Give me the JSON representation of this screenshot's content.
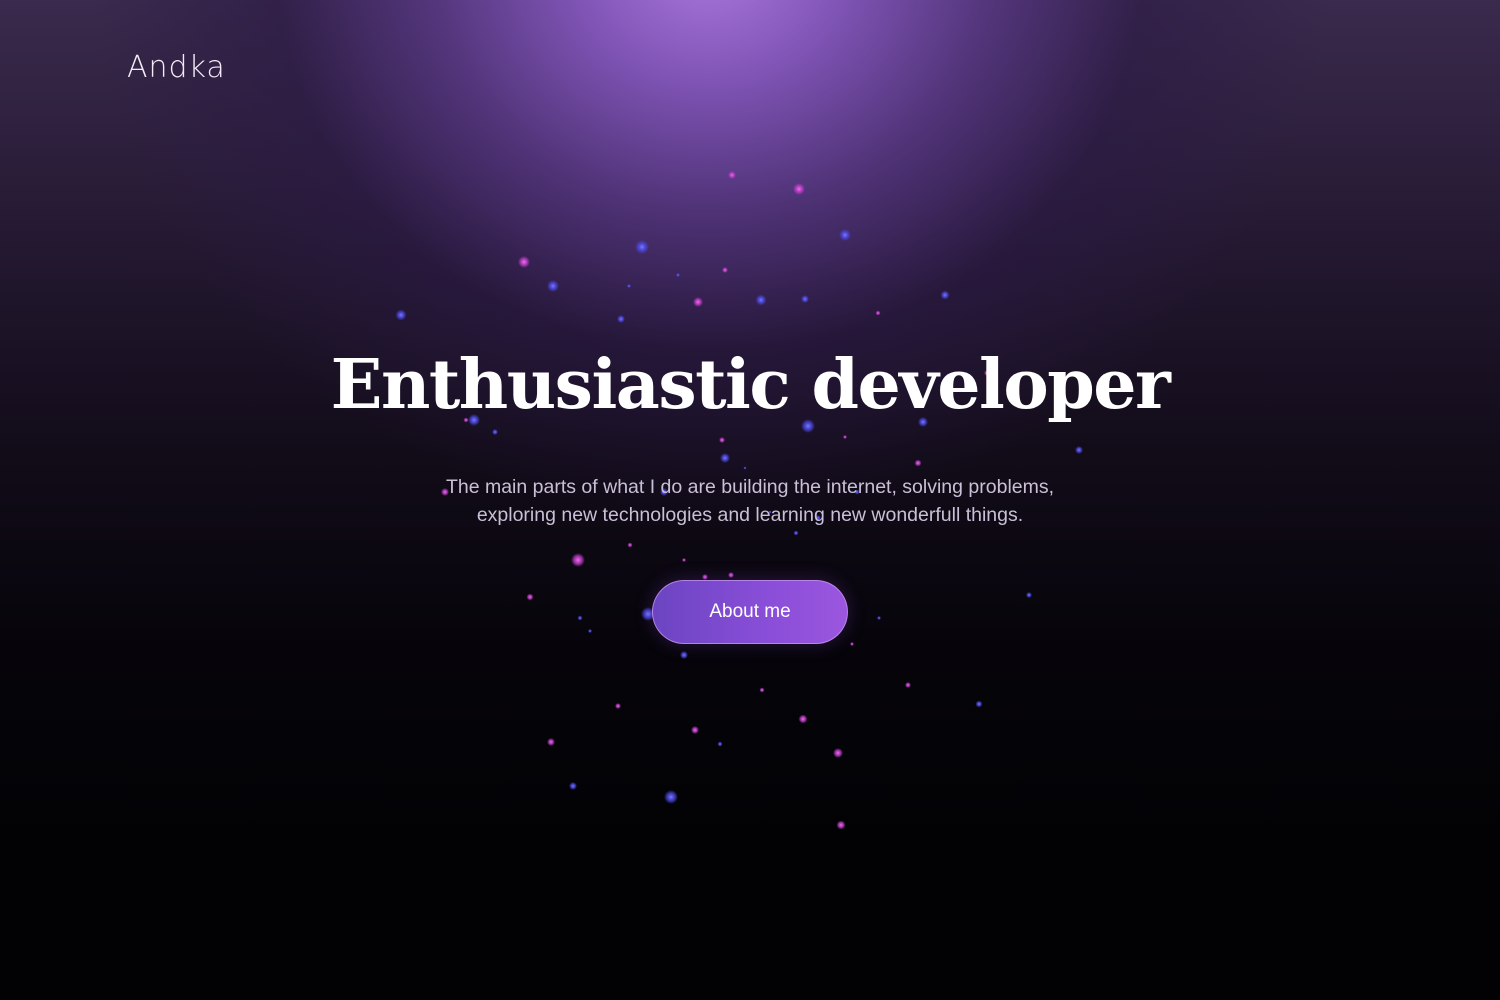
{
  "header": {
    "logo_text": "Andka"
  },
  "hero": {
    "title": "Enthusiastic developer",
    "description_line1": "The main parts of what I do are building the internet, solving problems,",
    "description_line2": "exploring new technologies and learning new wonderfull things.",
    "cta_label": "About me"
  },
  "colors": {
    "glow_top": "#b27ce6",
    "background_bottom": "#020204",
    "button_start": "#6b45c2",
    "button_end": "#9b56de",
    "particle_pink": "#d548d8",
    "particle_blue": "#5656f0"
  }
}
